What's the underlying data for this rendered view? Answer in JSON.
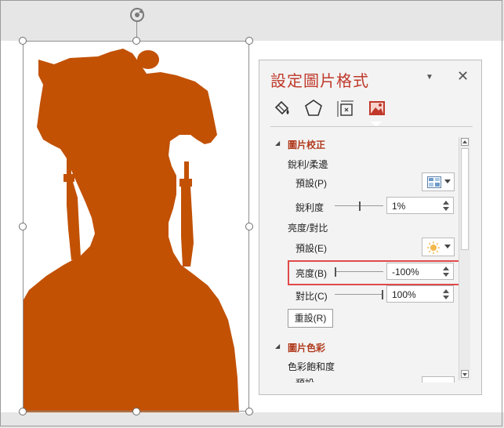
{
  "panel": {
    "title": "設定圖片格式",
    "close_glyph": "✕",
    "dropdown_glyph": "▼",
    "tabs": [
      {
        "name": "fill-line",
        "icon": "paint-bucket-icon"
      },
      {
        "name": "effects",
        "icon": "pentagon-icon"
      },
      {
        "name": "size-properties",
        "icon": "size-position-icon"
      },
      {
        "name": "picture",
        "icon": "picture-icon",
        "selected": true
      }
    ]
  },
  "picture_correction": {
    "header": "圖片校正",
    "sharpen_soften": {
      "label": "銳利/柔邊",
      "presets_label": "預設(P)",
      "presets_icon": "sharpen-preset-icon",
      "amount_label": "銳利度",
      "amount_value": "1%",
      "amount_fraction": 0.51
    },
    "brightness_contrast": {
      "label": "亮度/對比",
      "presets_label": "預設(E)",
      "presets_icon": "sun-icon",
      "brightness_label": "亮度(B)",
      "brightness_value": "-100%",
      "brightness_fraction": 0.0,
      "contrast_label": "對比(C)",
      "contrast_value": "100%",
      "contrast_fraction": 1.0
    },
    "reset_label": "重設(R)"
  },
  "picture_color": {
    "header": "圖片色彩",
    "saturation_label": "色彩飽和度",
    "presets_partial": "預設"
  },
  "colors": {
    "accent_red": "#c0392b",
    "highlight_red": "#e04a4a",
    "silhouette": "#c25104"
  }
}
